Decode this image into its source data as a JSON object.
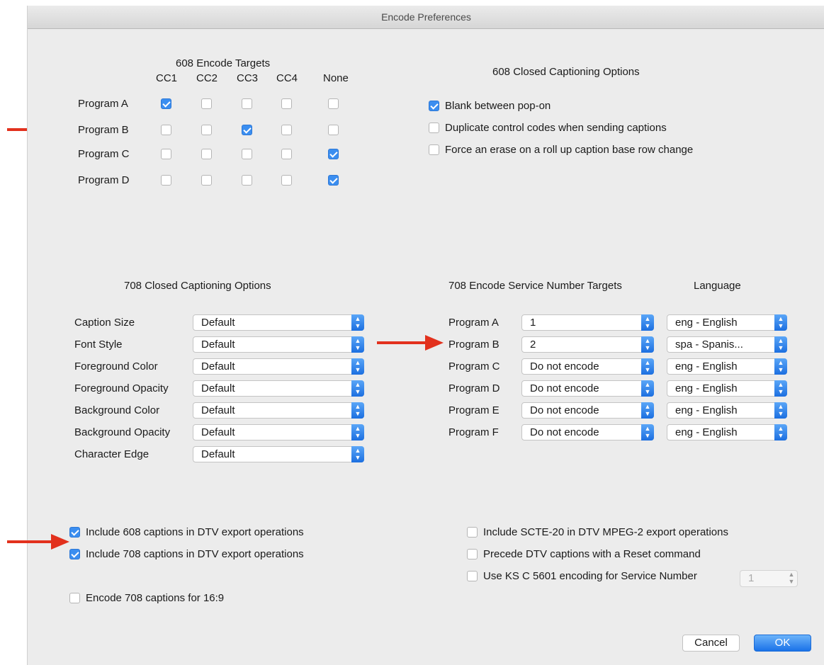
{
  "window": {
    "title": "Encode Preferences"
  },
  "cc608": {
    "targets_title": "608 Encode Targets",
    "columns": [
      "CC1",
      "CC2",
      "CC3",
      "CC4",
      "None"
    ],
    "rows": [
      {
        "label": "Program A",
        "checked": [
          true,
          false,
          false,
          false,
          false
        ]
      },
      {
        "label": "Program B",
        "checked": [
          false,
          false,
          true,
          false,
          false
        ]
      },
      {
        "label": "Program C",
        "checked": [
          false,
          false,
          false,
          false,
          true
        ]
      },
      {
        "label": "Program D",
        "checked": [
          false,
          false,
          false,
          false,
          true
        ]
      }
    ],
    "options_title": "608 Closed Captioning Options",
    "options": [
      {
        "label": "Blank between pop-on",
        "checked": true
      },
      {
        "label": "Duplicate control codes when sending captions",
        "checked": false
      },
      {
        "label": "Force an erase on a roll up caption base row change",
        "checked": false
      }
    ]
  },
  "cc708": {
    "options_title": "708 Closed Captioning Options",
    "options": [
      {
        "label": "Caption Size",
        "value": "Default"
      },
      {
        "label": "Font Style",
        "value": "Default"
      },
      {
        "label": "Foreground Color",
        "value": "Default"
      },
      {
        "label": "Foreground Opacity",
        "value": "Default"
      },
      {
        "label": "Background Color",
        "value": "Default"
      },
      {
        "label": "Background Opacity",
        "value": "Default"
      },
      {
        "label": "Character Edge",
        "value": "Default"
      }
    ],
    "service_title": "708 Encode Service Number Targets",
    "language_title": "Language",
    "services": [
      {
        "label": "Program A",
        "service": "1",
        "language": "eng - English"
      },
      {
        "label": "Program B",
        "service": "2",
        "language": "spa - Spanis..."
      },
      {
        "label": "Program C",
        "service": "Do not encode",
        "language": "eng - English"
      },
      {
        "label": "Program D",
        "service": "Do not encode",
        "language": "eng - English"
      },
      {
        "label": "Program E",
        "service": "Do not encode",
        "language": "eng - English"
      },
      {
        "label": "Program F",
        "service": "Do not encode",
        "language": "eng - English"
      }
    ]
  },
  "bottom": {
    "left": [
      {
        "label": "Include 608 captions in DTV export operations",
        "checked": true
      },
      {
        "label": "Include 708 captions in DTV export operations",
        "checked": true
      },
      {
        "label": "Encode 708 captions for 16:9",
        "checked": false
      }
    ],
    "right": [
      {
        "label": "Include SCTE-20 in DTV MPEG-2 export operations",
        "checked": false
      },
      {
        "label": "Precede DTV captions with a Reset command",
        "checked": false
      },
      {
        "label": "Use KS C 5601 encoding for Service Number",
        "checked": false
      }
    ],
    "ks_service_value": "1"
  },
  "buttons": {
    "cancel": "Cancel",
    "ok": "OK"
  },
  "colors": {
    "accent": "#3b8ef0",
    "annotation_arrow": "#e2311d"
  }
}
